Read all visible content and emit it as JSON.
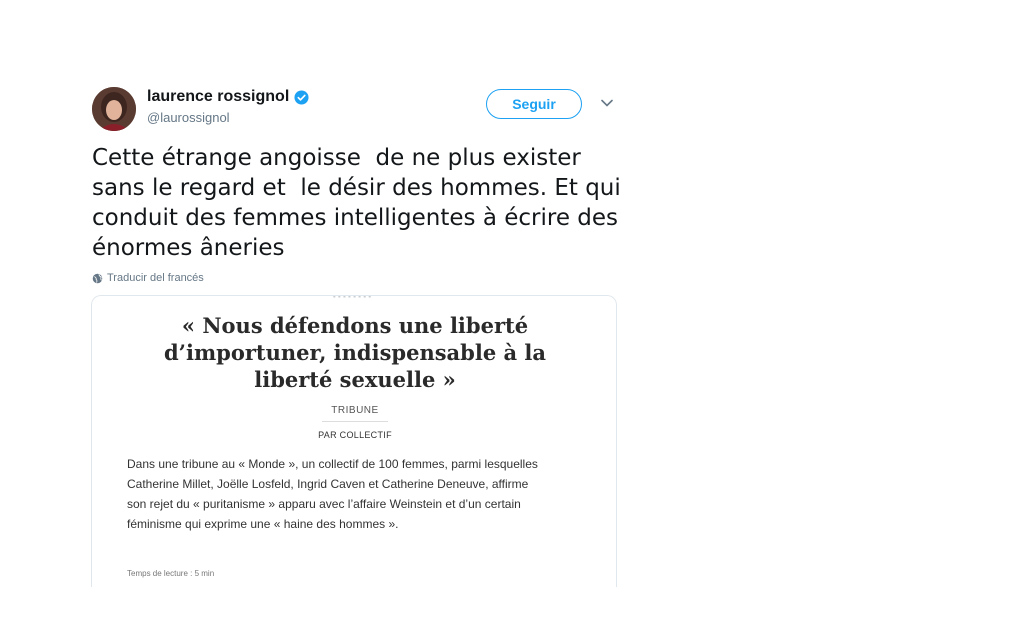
{
  "author": {
    "name": "laurence rossignol",
    "handle": "@laurossignol",
    "verified": true
  },
  "follow_button": {
    "label": "Seguir"
  },
  "icons": {
    "verified": "verified-badge-icon",
    "menu": "chevron-down-icon",
    "translate": "globe-icon"
  },
  "tweet": {
    "text": "Cette étrange angoisse  de ne plus exister\nsans le regard et  le désir des hommes. Et qui\nconduit des femmes intelligentes à écrire des\nénormes âneries",
    "translate_label": "Traducir del francés"
  },
  "card": {
    "title": "« Nous défendons une liberté\nd’importuner, indispensable à la\nliberté sexuelle »",
    "rubric": "TRIBUNE",
    "byline": "PAR COLLECTIF",
    "summary": "Dans une tribune au « Monde », un collectif de 100 femmes, parmi lesquelles Catherine Millet, Joëlle Losfeld, Ingrid Caven et Catherine Deneuve, affirme son rejet du « puritanisme » apparu avec l’affaire Weinstein et d’un certain féminisme qui exprime une « haine des hommes ».",
    "read_time": "Temps de lecture : 5 min"
  },
  "colors": {
    "accent": "#1da1f2",
    "text": "#14171a",
    "secondary": "#657786"
  }
}
